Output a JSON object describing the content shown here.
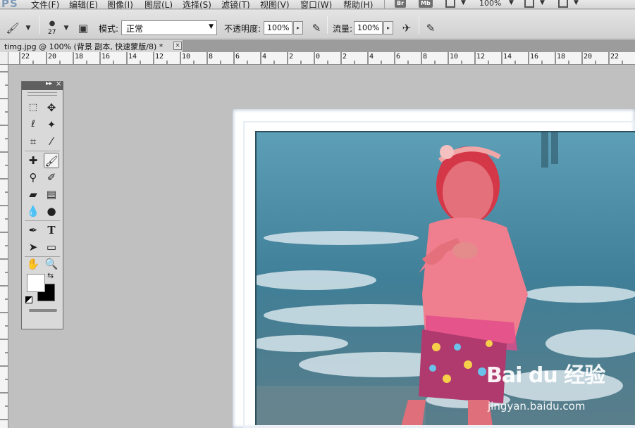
{
  "app": {
    "logo": "PS",
    "menus": [
      "文件(F)",
      "编辑(E)",
      "图像(I)",
      "图层(L)",
      "选择(S)",
      "滤镜(T)",
      "视图(V)",
      "窗口(W)",
      "帮助(H)"
    ],
    "bridge_button": "Br",
    "minibridge_button": "Mb",
    "zoom": "100%"
  },
  "options": {
    "brush_size": "27",
    "mode_label": "模式:",
    "mode_value": "正常",
    "opacity_label": "不透明度:",
    "opacity_value": "100%",
    "flow_label": "流量:",
    "flow_value": "100%"
  },
  "document": {
    "tab_title": "timg.jpg @ 100% (背景 副本, 快速蒙版/8) *",
    "tab_close": "×"
  },
  "ruler": {
    "top_labels": [
      "22",
      "20",
      "18",
      "16",
      "14",
      "12",
      "10",
      "8",
      "6",
      "4",
      "2",
      "0",
      "2",
      "4",
      "6",
      "8",
      "10",
      "12",
      "14",
      "16",
      "18",
      "20",
      "22"
    ]
  },
  "watermark": {
    "logo": "Bai du 经验",
    "url": "jingyan.baidu.com"
  },
  "colors": {
    "foreground": "#ffffff",
    "background": "#000000"
  }
}
